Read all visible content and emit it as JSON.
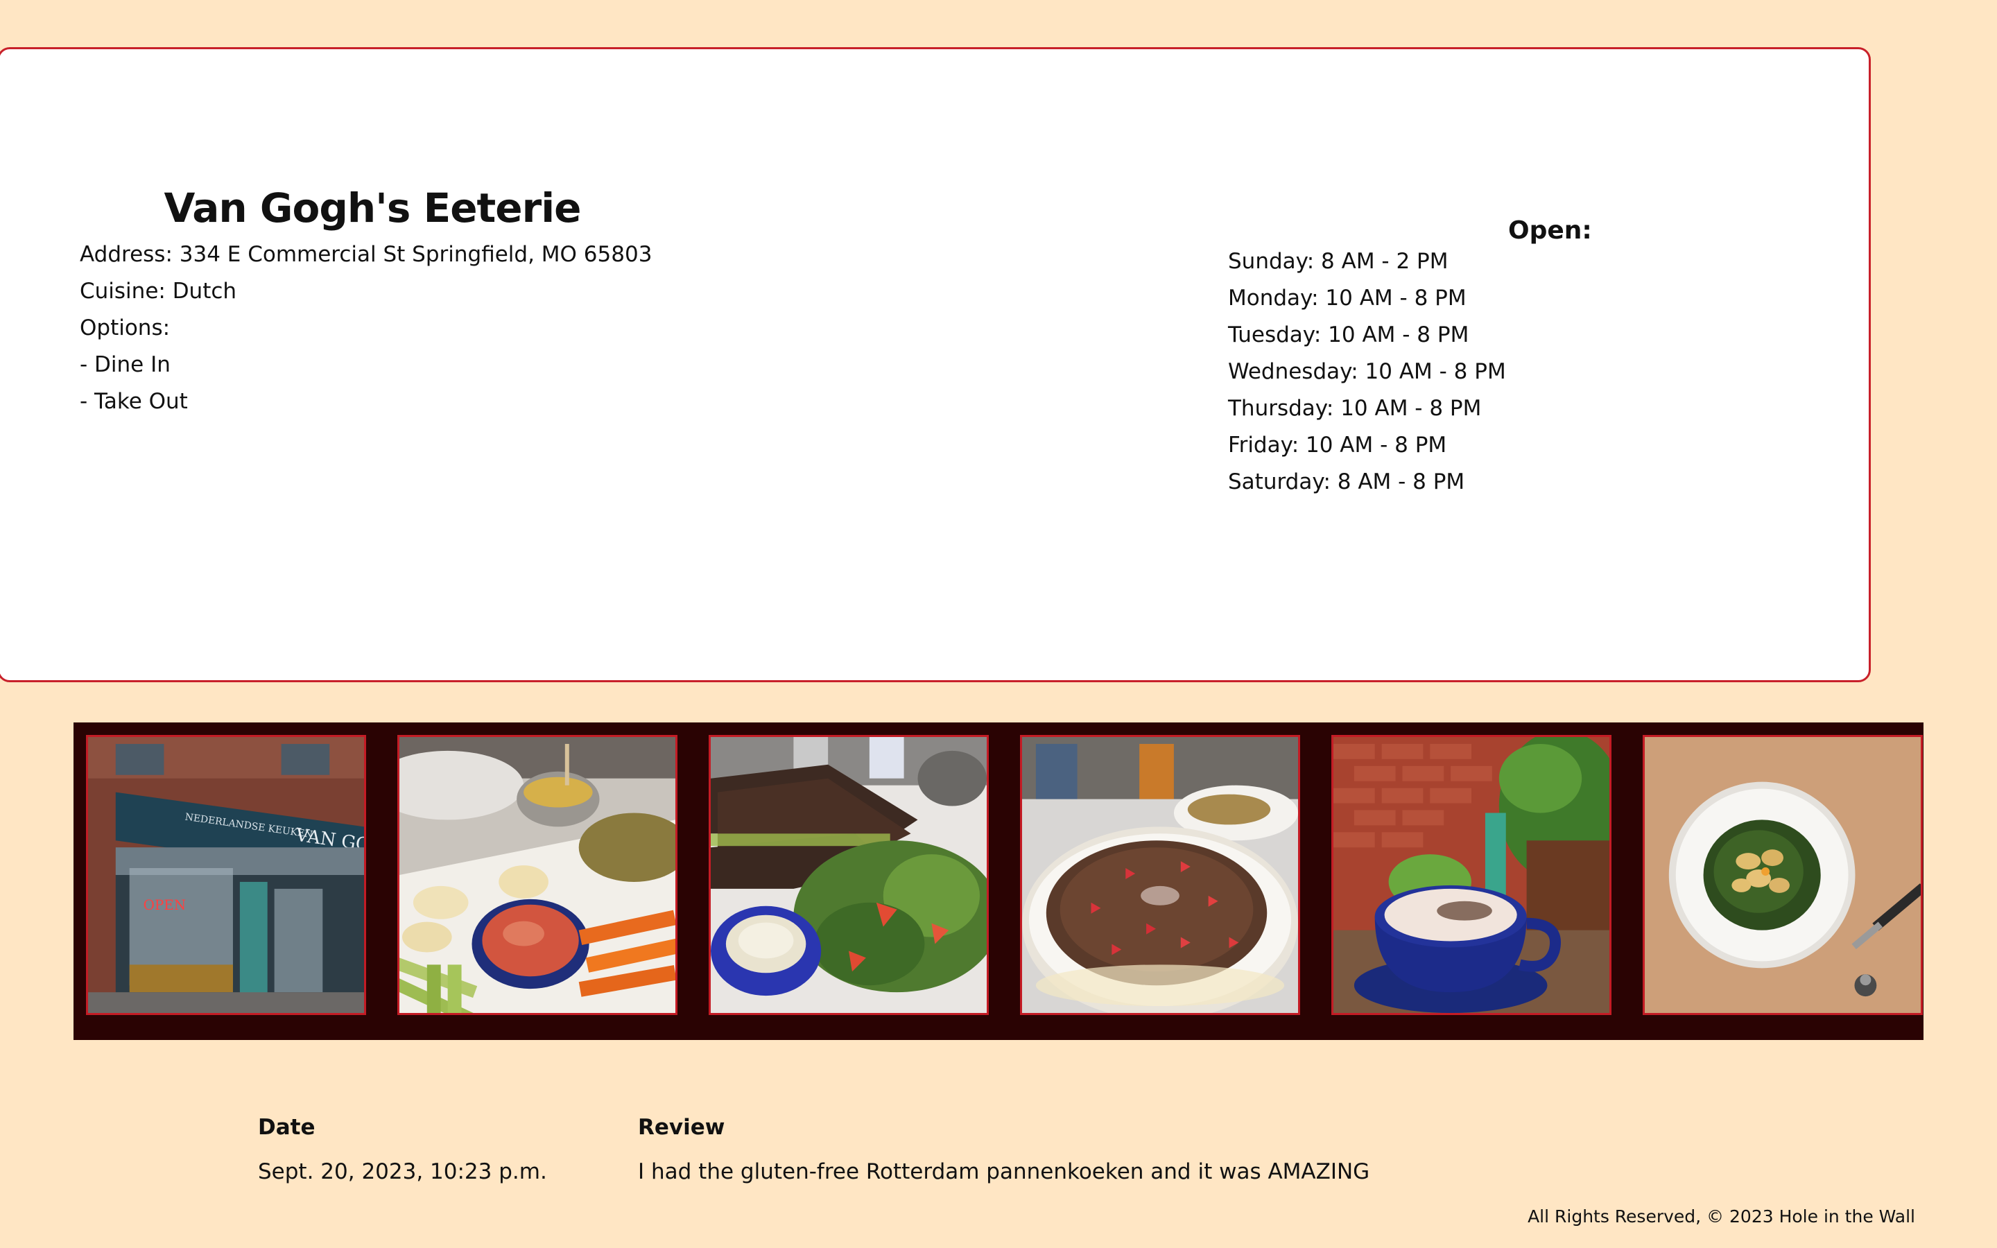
{
  "restaurant": {
    "name": "Van Gogh's Eeterie",
    "address": "Address: 334 E Commercial St Springfield, MO 65803",
    "cuisine": "Cuisine: Dutch",
    "options_label": "Options:",
    "options": [
      "- Dine In",
      "- Take Out"
    ]
  },
  "hours": {
    "heading": "Open:",
    "days": [
      "Sunday: 8 AM - 2 PM",
      "Monday: 10 AM - 8 PM",
      "Tuesday: 10 AM - 8 PM",
      "Wednesday: 10 AM - 8 PM",
      "Thursday: 10 AM - 8 PM",
      "Friday: 10 AM - 8 PM",
      "Saturday: 8 AM - 8 PM"
    ]
  },
  "gallery": {
    "photos": [
      {
        "icon": "storefront-photo",
        "sign_text": "VAN GOGH'S",
        "open_sign": "OPEN"
      },
      {
        "icon": "hummus-platter-photo"
      },
      {
        "icon": "sandwich-salad-photo"
      },
      {
        "icon": "chocolate-pancake-photo"
      },
      {
        "icon": "cappuccino-photo"
      },
      {
        "icon": "pasta-bowl-photo"
      }
    ]
  },
  "reviews": {
    "headers": {
      "date": "Date",
      "review": "Review"
    },
    "rows": [
      {
        "date": "Sept. 20, 2023, 10:23 p.m.",
        "text": "I had the gluten-free Rotterdam pannenkoeken and it was AMAZING"
      }
    ]
  },
  "footer": {
    "text": "All Rights Reserved, © 2023 Hole in the Wall"
  }
}
